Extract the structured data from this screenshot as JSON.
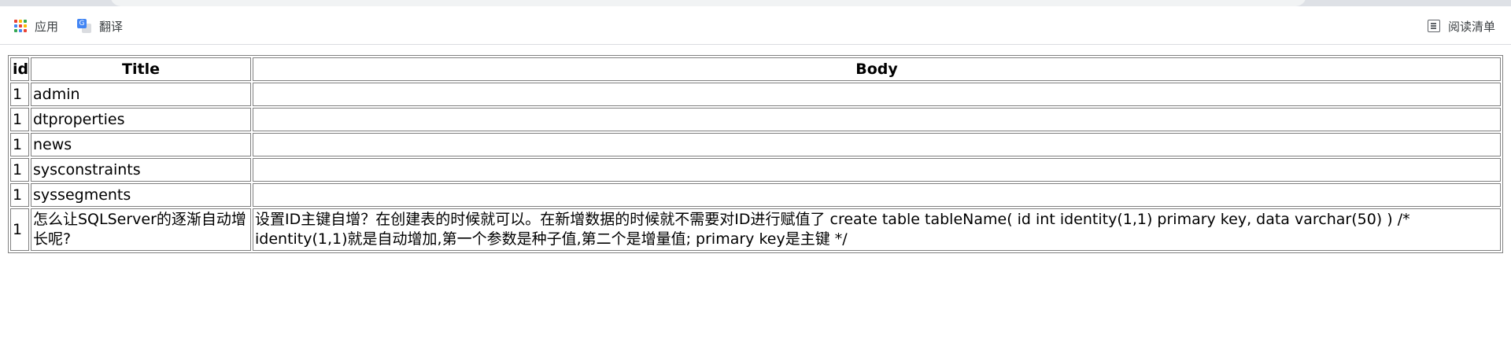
{
  "bookmarks": {
    "apps_label": "应用",
    "translate_label": "翻译",
    "reading_list_label": "阅读清单",
    "apps_colors": [
      "#ea4335",
      "#fbbc04",
      "#34a853",
      "#4285f4",
      "#ea4335",
      "#fbbc04",
      "#34a853",
      "#4285f4",
      "#ea4335"
    ]
  },
  "table": {
    "headers": {
      "id": "id",
      "title": "Title",
      "body": "Body"
    },
    "rows": [
      {
        "id": "1",
        "title": "admin",
        "body": ""
      },
      {
        "id": "1",
        "title": "dtproperties",
        "body": ""
      },
      {
        "id": "1",
        "title": "news",
        "body": ""
      },
      {
        "id": "1",
        "title": "sysconstraints",
        "body": ""
      },
      {
        "id": "1",
        "title": "syssegments",
        "body": ""
      },
      {
        "id": "1",
        "title": "怎么让SQLServer的逐渐自动增长呢?",
        "body": "设置ID主键自增？在创建表的时候就可以。在新增数据的时候就不需要对ID进行赋值了 create table tableName( id int identity(1,1) primary key, data varchar(50) ) /* identity(1,1)就是自动增加,第一个参数是种子值,第二个是增量值; primary key是主键 */"
      }
    ]
  }
}
